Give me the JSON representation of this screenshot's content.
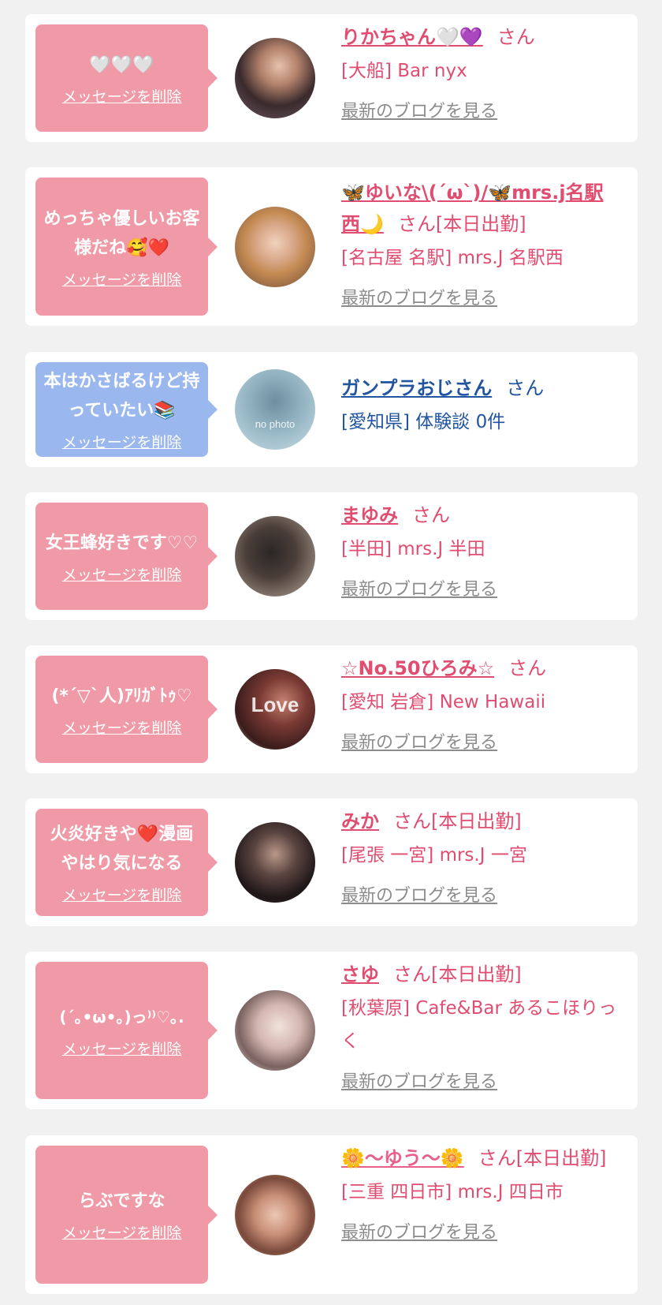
{
  "colors": {
    "page_bg": "#f1f1f1",
    "card_bg": "#ffffff",
    "bubble_pink": "#ef9aa6",
    "bubble_blue": "#9ab7ee",
    "name_pink": "#e14d70",
    "name_blue": "#2255a0",
    "blog_gray": "#8c8c8c"
  },
  "entries": [
    {
      "message": "🤍🤍🤍",
      "delete_label": "メッセージを削除",
      "name": "りかちゃん🤍💜",
      "san": "さん",
      "shop": "[大船] Bar nyx",
      "blog_label": "最新のブログを見る"
    },
    {
      "message": "めっちゃ優しいお客様だね🥰❤️",
      "delete_label": "メッセージを削除",
      "name": "🦋ゆいな\\(´ω`)/🦋mrs.j名駅西🌙",
      "san": "さん[本日出勤]",
      "shop": "[名古屋 名駅] mrs.J 名駅西",
      "blog_label": "最新のブログを見る"
    },
    {
      "message": "本はかさばるけど持っていたい📚",
      "delete_label": "メッセージを削除",
      "name": "ガンプラおじさん",
      "san": "さん",
      "shop": "[愛知県] 体験談 0件",
      "avatar_text": "no photo"
    },
    {
      "message": "女王蜂好きです♡♡",
      "delete_label": "メッセージを削除",
      "name": "まゆみ",
      "san": "さん",
      "shop": "[半田] mrs.J 半田",
      "blog_label": "最新のブログを見る"
    },
    {
      "message": "(*´▽`人)ｱﾘｶﾞﾄｩ♡",
      "delete_label": "メッセージを削除",
      "name": "☆No.50ひろみ☆",
      "san": "さん",
      "shop": "[愛知 岩倉] New Hawaii",
      "blog_label": "最新のブログを見る",
      "avatar_text": "Love"
    },
    {
      "message": "火炎好きや❤️漫画やはり気になる",
      "delete_label": "メッセージを削除",
      "name": "みか",
      "san": "さん[本日出勤]",
      "shop": "[尾張 一宮] mrs.J 一宮",
      "blog_label": "最新のブログを見る"
    },
    {
      "message": "(´｡•ω•｡)っ⁾⁾♡｡.",
      "delete_label": "メッセージを削除",
      "name": "さゆ",
      "san": "さん[本日出勤]",
      "shop": "[秋葉原] Cafe&Bar あるこほりっく",
      "blog_label": "最新のブログを見る"
    },
    {
      "message": "らぶですな",
      "delete_label": "メッセージを削除",
      "name": "🌼〜ゆう〜🌼",
      "san": "さん[本日出勤]",
      "shop": "[三重 四日市] mrs.J 四日市",
      "blog_label": "最新のブログを見る"
    }
  ]
}
